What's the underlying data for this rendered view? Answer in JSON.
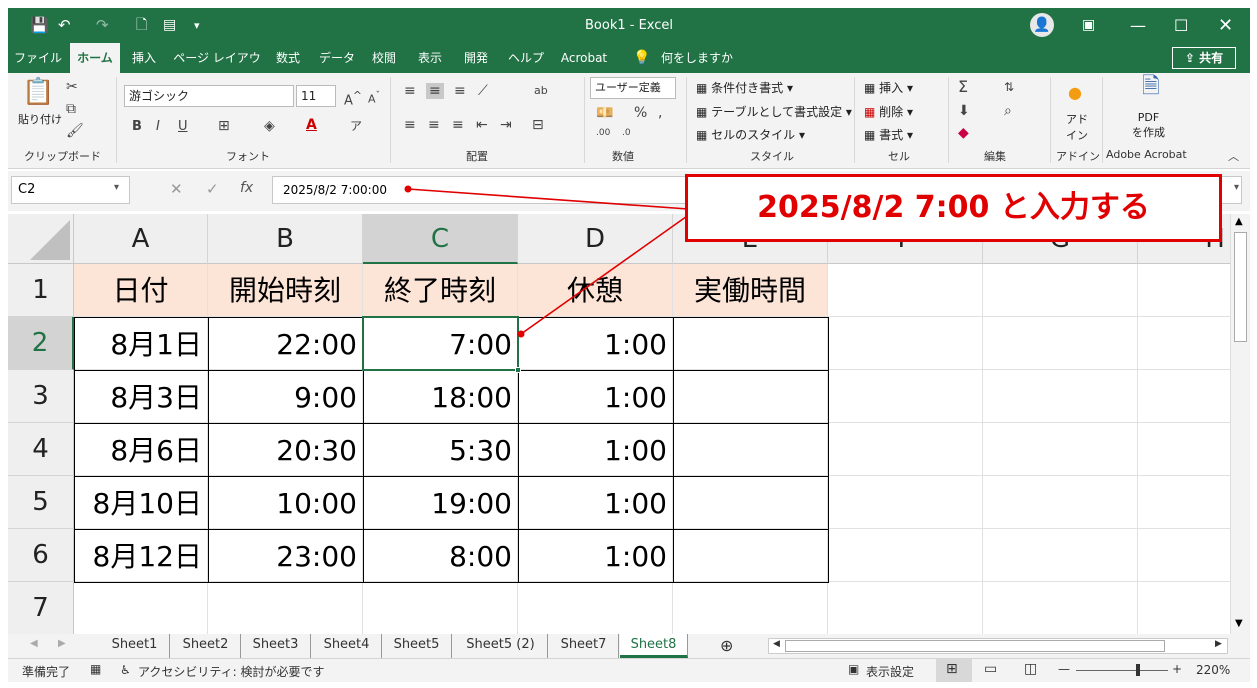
{
  "title": "Book1  -  Excel",
  "menu": [
    "ファイル",
    "ホーム",
    "挿入",
    "ページ レイアウト",
    "数式",
    "データ",
    "校閲",
    "表示",
    "開発",
    "ヘルプ",
    "Acrobat",
    "何をしますか"
  ],
  "share": "共有",
  "ribbon": {
    "paste": "貼り付け",
    "font_name": "游ゴシック",
    "font_size": "11",
    "number_format": "ユーザー定義",
    "conditional": "条件付き書式",
    "as_table": "テーブルとして書式設定",
    "cell_style": "セルのスタイル",
    "insert": "挿入",
    "delete": "削除",
    "format": "書式",
    "addin": "アド\nイン",
    "pdf": "PDF\nを作成",
    "groups": [
      "クリップボード",
      "フォント",
      "配置",
      "数値",
      "スタイル",
      "セル",
      "編集",
      "アドイン",
      "Adobe Acrobat"
    ]
  },
  "name_box": "C2",
  "formula": "2025/8/2  7:00:00",
  "columns": [
    "A",
    "B",
    "C",
    "D",
    "E",
    "F",
    "G",
    "H"
  ],
  "rows": [
    "1",
    "2",
    "3",
    "4",
    "5",
    "6",
    "7"
  ],
  "table": {
    "header": [
      "日付",
      "開始時刻",
      "終了時刻",
      "休憩",
      "実働時間"
    ],
    "data": [
      [
        "8月1日",
        "22:00",
        "7:00",
        "1:00",
        ""
      ],
      [
        "8月3日",
        "9:00",
        "18:00",
        "1:00",
        ""
      ],
      [
        "8月6日",
        "20:30",
        "5:30",
        "1:00",
        ""
      ],
      [
        "8月10日",
        "10:00",
        "19:00",
        "1:00",
        ""
      ],
      [
        "8月12日",
        "23:00",
        "8:00",
        "1:00",
        ""
      ]
    ]
  },
  "sheets": [
    "Sheet1",
    "Sheet2",
    "Sheet3",
    "Sheet4",
    "Sheet5",
    "Sheet5 (2)",
    "Sheet7",
    "Sheet8"
  ],
  "status": {
    "ready": "準備完了",
    "accessibility": "アクセシビリティ: 検討が必要です",
    "display": "表示設定",
    "zoom": "220%"
  },
  "callout": "2025/8/2 7:00  と入力する",
  "colors": {
    "excel_green": "#217346",
    "header_fill": "#fce4d6",
    "callout_red": "#e00000"
  }
}
